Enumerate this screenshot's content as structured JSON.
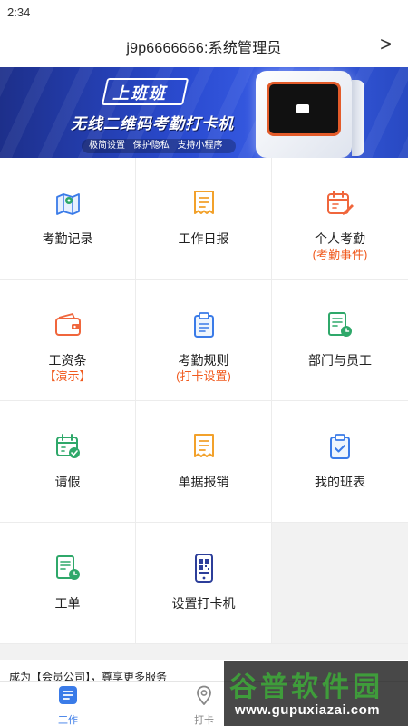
{
  "status_bar": {
    "time": "2:34"
  },
  "header": {
    "title": "j9p6666666:系统管理员",
    "chevron": ">"
  },
  "banner": {
    "brand": "上班班",
    "slogan": "无线二维码考勤打卡机",
    "taglines": [
      "极简设置",
      "保护隐私",
      "支持小程序"
    ]
  },
  "grid": {
    "items": [
      {
        "label": "考勤记录",
        "sub": "",
        "icon": "map-icon"
      },
      {
        "label": "工作日报",
        "sub": "",
        "icon": "receipt-icon"
      },
      {
        "label": "个人考勤",
        "sub": "(考勤事件)",
        "icon": "calendar-edit-icon"
      },
      {
        "label": "工资条",
        "sub": "【演示】",
        "icon": "wallet-icon"
      },
      {
        "label": "考勤规则",
        "sub": "(打卡设置)",
        "icon": "clipboard-icon"
      },
      {
        "label": "部门与员工",
        "sub": "",
        "icon": "document-clock-icon"
      },
      {
        "label": "请假",
        "sub": "",
        "icon": "calendar-check-icon"
      },
      {
        "label": "单据报销",
        "sub": "",
        "icon": "receipt-icon"
      },
      {
        "label": "我的班表",
        "sub": "",
        "icon": "clipboard-check-icon"
      },
      {
        "label": "工单",
        "sub": "",
        "icon": "document-clock-icon"
      },
      {
        "label": "设置打卡机",
        "sub": "",
        "icon": "phone-qr-icon"
      }
    ]
  },
  "promo": {
    "text": "成为【会员公司】，尊享更多服务"
  },
  "tabbar": {
    "tabs": [
      {
        "label": "工作",
        "icon": "work-list-icon"
      },
      {
        "label": "打卡",
        "icon": "location-pin-icon"
      }
    ]
  },
  "watermark": {
    "main": "谷普软件园",
    "url": "www.gupuxiazai.com"
  },
  "colors": {
    "accent_blue": "#3a7be8",
    "accent_orange": "#f05a1e",
    "icon_green": "#2fa86a",
    "icon_amber": "#f2a12b",
    "icon_red": "#f0663c",
    "icon_navy": "#2c3e9a"
  }
}
